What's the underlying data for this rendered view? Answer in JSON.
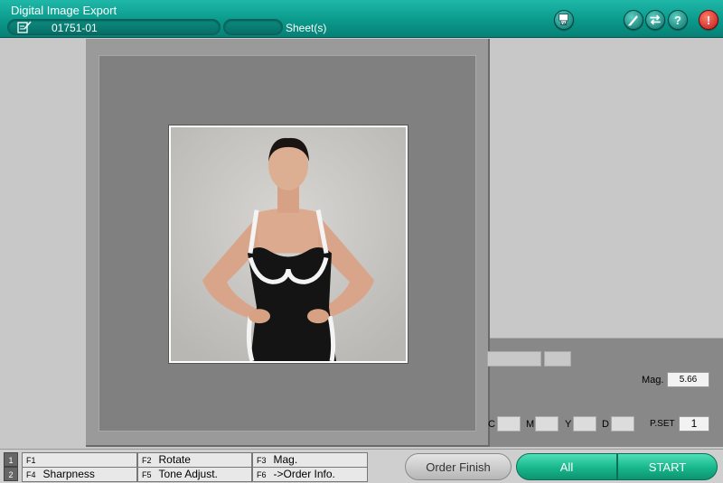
{
  "header": {
    "title": "Digital Image Export",
    "order_no": "01751-01",
    "sheet_value": "",
    "sheet_label": "Sheet(s)",
    "icons": [
      "edit-icon",
      "om-icon",
      "pen-icon",
      "swap-icon",
      "help-icon",
      "alert-icon"
    ],
    "help_glyph": "?",
    "alert_glyph": "!"
  },
  "info": {
    "mag_label": "Mag.",
    "mag_value": "5.66",
    "c_label": "C",
    "m_label": "M",
    "y_label": "Y",
    "d_label": "D",
    "pset_label": "P.SET",
    "pset_value": "1"
  },
  "function_keys": {
    "row1_num": "1",
    "row2_num": "2",
    "f1": {
      "key": "F1",
      "label": ""
    },
    "f2": {
      "key": "F2",
      "label": "Rotate"
    },
    "f3": {
      "key": "F3",
      "label": "Mag."
    },
    "f4": {
      "key": "F4",
      "label": "Sharpness"
    },
    "f5": {
      "key": "F5",
      "label": "Tone Adjust."
    },
    "f6": {
      "key": "F6",
      "label": "->Order Info."
    }
  },
  "buttons": {
    "order_finish": "Order Finish",
    "all": "All",
    "start": "START"
  },
  "colors": {
    "header_teal": "#0a9a8c",
    "start_green": "#17b58a",
    "alert_red": "#c01818"
  }
}
